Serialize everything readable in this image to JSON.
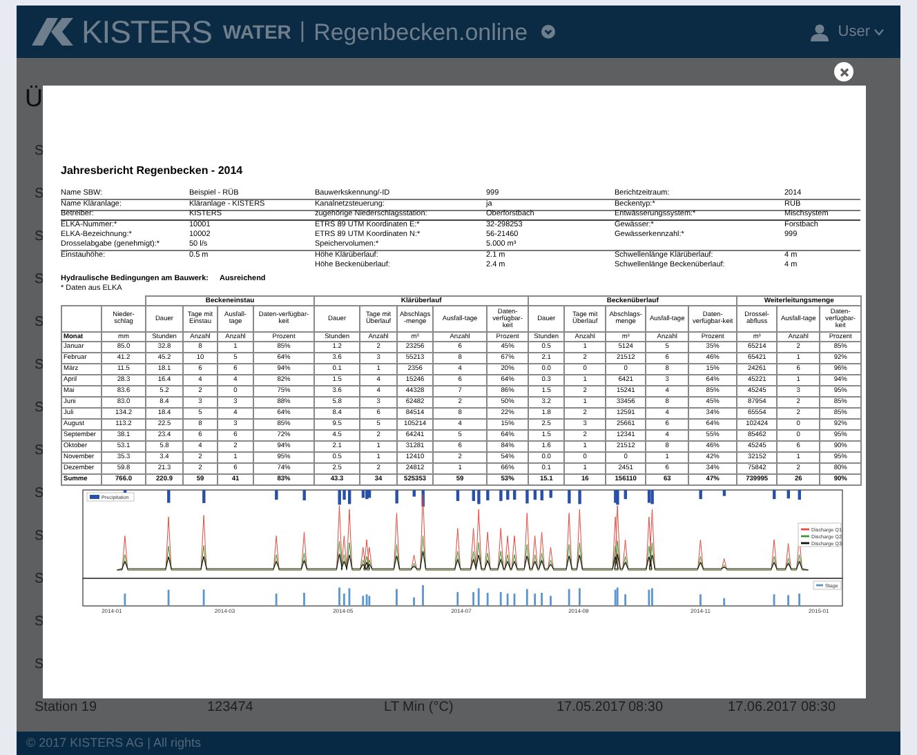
{
  "header": {
    "brand": "KISTERS",
    "product": "WATER",
    "separator": "|",
    "app": "Regenbecken.online",
    "user": "User"
  },
  "page": {
    "heading": "Ü",
    "rows": [
      {
        "cells": [
          "S"
        ]
      },
      {
        "cells": [
          "S"
        ]
      },
      {
        "cells": [
          "S"
        ]
      },
      {
        "cells": [
          "S"
        ]
      },
      {
        "cells": [
          "S"
        ]
      },
      {
        "cells": [
          "S"
        ]
      },
      {
        "cells": [
          "S"
        ]
      },
      {
        "cells": [
          "S"
        ]
      },
      {
        "cells": [
          "S"
        ]
      },
      {
        "cells": [
          "S"
        ]
      },
      {
        "cells": [
          "S"
        ]
      },
      {
        "cells": [
          "S"
        ]
      },
      {
        "cells": [
          "S"
        ]
      },
      {
        "cells": [
          "Station 19",
          "123474",
          "LT Min (°C)",
          "17.05.2017",
          "08:30",
          "17.06.2017",
          "08:30"
        ]
      }
    ]
  },
  "report": {
    "title": "Jahresbericht Regenbecken - 2014",
    "info_groups": [
      [
        {
          "left": {
            "label": "Name SBW:",
            "value": "Beispiel - RÜB"
          },
          "middle": {
            "label": "Bauwerkskennung/-ID",
            "value": "999"
          },
          "right": {
            "label": "Berichtzeitraum:",
            "value": "2014"
          }
        },
        {
          "left": {
            "label": "Name Kläranlage:",
            "value": "Kläranlage - KISTERS"
          },
          "middle": {
            "label": "Kanalnetzsteuerung:",
            "value": "ja"
          },
          "right": {
            "label": "Beckentyp:*",
            "value": "RÜB"
          }
        },
        {
          "left": {
            "label": "Betreiber:",
            "value": "KISTERS"
          },
          "middle": {
            "label": "zugehörige Niederschlagsstation:",
            "value": "Oberforstbach"
          },
          "right": {
            "label": "Entwässerungssystem:*",
            "value": "Mischsystem"
          }
        }
      ],
      [
        {
          "left": {
            "label": "ELKA-Nummer:*",
            "value": "10001"
          },
          "middle": {
            "label": "ETRS 89 UTM Koordinaten E:*",
            "value": "32-298253"
          },
          "right": {
            "label": "Gewässer:*",
            "value": "Forstbach"
          }
        },
        {
          "left": {
            "label": "ELKA-Bezeichnung:*",
            "value": "10002"
          },
          "middle": {
            "label": "ETRS 89 UTM Koordinaten N:*",
            "value": "56-21460"
          },
          "right": {
            "label": "Gewässerkennzahl:*",
            "value": "999"
          }
        },
        {
          "left": {
            "label": "Drosselabgabe (genehmigt):*",
            "value": "50 l/s"
          },
          "middle": {
            "label": "Speichervolumen:*",
            "value": "5.000 m³"
          }
        }
      ],
      [
        {
          "left": {
            "label": "Einstauhöhe:",
            "value": "0.5 m"
          },
          "middle": {
            "label": "Höhe Klärüberlauf:",
            "value": "2.1 m"
          },
          "right": {
            "label": "Schwellenlänge Klärüberlauf:",
            "value": "4 m"
          }
        },
        {
          "middle": {
            "label": "Höhe Beckenüberlauf:",
            "value": "2.4 m"
          },
          "right": {
            "label": "Schwellenlänge Beckenüberlauf:",
            "value": "4 m"
          }
        }
      ]
    ],
    "hydraulic": {
      "label": "Hydraulische Bedingungen am Bauwerk:",
      "value": "Ausreichend"
    },
    "note": "* Daten aus ELKA",
    "table": {
      "column_groups": [
        {
          "columns": [
            {
              "unit": "Monat"
            },
            {
              "label": "Nieder-schlag",
              "unit": "mm"
            }
          ]
        },
        {
          "label": "Beckeneinstau",
          "columns": [
            {
              "label": "Dauer",
              "unit": "Stunden"
            },
            {
              "label": "Tage mit Einstau",
              "unit": "Anzahl"
            },
            {
              "label": "Ausfall-tage",
              "unit": "Anzahl"
            },
            {
              "label": "Daten-verfügbar-keit",
              "unit": "Prozent"
            }
          ]
        },
        {
          "label": "Klärüberlauf",
          "columns": [
            {
              "label": "Dauer",
              "unit": "Stunden"
            },
            {
              "label": "Tage mit Überlauf",
              "unit": "Anzahl"
            },
            {
              "label": "Abschlags-menge",
              "unit": "m³"
            },
            {
              "label": "Ausfall-tage",
              "unit": "Anzahl"
            },
            {
              "label": "Daten-verfügbar-keit",
              "unit": "Prozent"
            }
          ]
        },
        {
          "label": "Beckenüberlauf",
          "columns": [
            {
              "label": "Dauer",
              "unit": "Stunden"
            },
            {
              "label": "Tage mit Überlauf",
              "unit": "Anzahl"
            },
            {
              "label": "Abschlags-menge",
              "unit": "m³"
            },
            {
              "label": "Ausfall-tage",
              "unit": "Anzahl"
            },
            {
              "label": "Daten-verfügbar-keit",
              "unit": "Prozent"
            }
          ]
        },
        {
          "label": "Weiterleitungsmenge",
          "columns": [
            {
              "label": "Drossel-abfluss",
              "unit": "m³"
            },
            {
              "label": "Ausfall-tage",
              "unit": "Anzahl"
            },
            {
              "label": "Daten-verfügbar-keit",
              "unit": "Prozent"
            }
          ]
        }
      ],
      "rows": [
        [
          "Januar",
          "85.0",
          "32.8",
          "8",
          "1",
          "85%",
          "1.2",
          "2",
          "23256",
          "6",
          "45%",
          "0.5",
          "1",
          "5124",
          "5",
          "35%",
          "65214",
          "2",
          "85%"
        ],
        [
          "Februar",
          "41.2",
          "45.2",
          "10",
          "5",
          "64%",
          "3.6",
          "3",
          "55213",
          "8",
          "67%",
          "2.1",
          "2",
          "21512",
          "6",
          "46%",
          "65421",
          "1",
          "92%"
        ],
        [
          "März",
          "11.5",
          "18.1",
          "6",
          "6",
          "94%",
          "0.1",
          "1",
          "2356",
          "4",
          "20%",
          "0.0",
          "0",
          "0",
          "8",
          "15%",
          "24261",
          "6",
          "96%"
        ],
        [
          "April",
          "28.3",
          "16.4",
          "4",
          "4",
          "82%",
          "1.5",
          "4",
          "15246",
          "6",
          "64%",
          "0.3",
          "1",
          "6421",
          "3",
          "64%",
          "45221",
          "1",
          "94%"
        ],
        [
          "Mai",
          "83.6",
          "5.2",
          "2",
          "0",
          "75%",
          "3.6",
          "4",
          "44328",
          "7",
          "86%",
          "1.5",
          "2",
          "15241",
          "4",
          "85%",
          "45245",
          "3",
          "95%"
        ],
        [
          "Juni",
          "83.0",
          "8.4",
          "3",
          "3",
          "88%",
          "5.8",
          "3",
          "62482",
          "2",
          "50%",
          "3.2",
          "1",
          "33456",
          "8",
          "45%",
          "87954",
          "2",
          "85%"
        ],
        [
          "Juli",
          "134.2",
          "18.4",
          "5",
          "4",
          "64%",
          "8.4",
          "6",
          "84514",
          "8",
          "22%",
          "1.8",
          "2",
          "12591",
          "4",
          "34%",
          "65554",
          "2",
          "85%"
        ],
        [
          "August",
          "113.2",
          "22.5",
          "8",
          "3",
          "85%",
          "9.5",
          "5",
          "105214",
          "4",
          "15%",
          "2.5",
          "3",
          "25661",
          "6",
          "64%",
          "102424",
          "0",
          "92%"
        ],
        [
          "September",
          "38.1",
          "23.4",
          "6",
          "6",
          "72%",
          "4.5",
          "2",
          "64241",
          "5",
          "64%",
          "1.5",
          "2",
          "12341",
          "4",
          "55%",
          "85462",
          "0",
          "95%"
        ],
        [
          "Oktober",
          "53.1",
          "5.8",
          "4",
          "2",
          "94%",
          "2.1",
          "1",
          "31281",
          "6",
          "84%",
          "1.6",
          "1",
          "21512",
          "8",
          "46%",
          "45245",
          "6",
          "90%"
        ],
        [
          "November",
          "35.3",
          "3.4",
          "2",
          "1",
          "95%",
          "0.5",
          "1",
          "12410",
          "2",
          "54%",
          "0.0",
          "0",
          "0",
          "1",
          "42%",
          "32152",
          "1",
          "95%"
        ],
        [
          "Dezember",
          "59.8",
          "21.3",
          "2",
          "6",
          "74%",
          "2.5",
          "2",
          "24812",
          "1",
          "66%",
          "0.1",
          "1",
          "2451",
          "6",
          "34%",
          "75842",
          "2",
          "80%"
        ]
      ],
      "total": [
        "Summe",
        "766.0",
        "220.9",
        "59",
        "41",
        "83%",
        "43.3",
        "34",
        "525353",
        "59",
        "53%",
        "15.1",
        "16",
        "156110",
        "63",
        "47%",
        "739995",
        "26",
        "90%"
      ]
    },
    "chart": {
      "top_legend": {
        "name": "Precipitation",
        "color": "#2850a8"
      },
      "discharge_legend": [
        {
          "name": "Discharge Q1",
          "color": "#e8483c"
        },
        {
          "name": "Discharge Q2",
          "color": "#3a9a3a"
        },
        {
          "name": "Discharge Q3",
          "color": "#111111"
        }
      ],
      "stage_legend": {
        "name": "Stage",
        "color": "#5a95cf"
      },
      "x_ticks": [
        "2014-01",
        "2014-03",
        "2014-05",
        "2014-07",
        "2014-09",
        "2014-11",
        "2015-01"
      ]
    }
  },
  "footer": "© 2017 KISTERS AG | All rights"
}
